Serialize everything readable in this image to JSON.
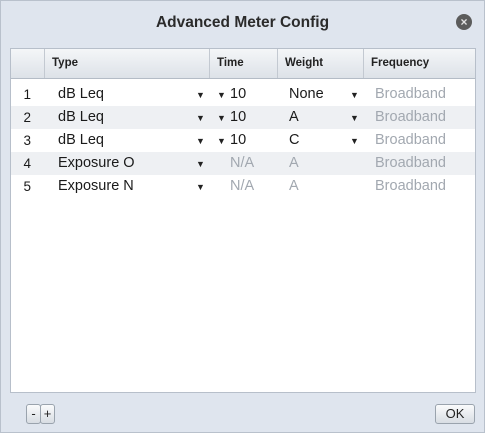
{
  "dialog": {
    "title": "Advanced Meter Config",
    "close_glyph": "×"
  },
  "table": {
    "columns": [
      "Type",
      "Time",
      "Weight",
      "Frequency"
    ],
    "rows": [
      {
        "num": "1",
        "type": "dB Leq",
        "time": "10",
        "weight": "None",
        "frequency": "Broadband",
        "time_enabled": true,
        "weight_enabled": true
      },
      {
        "num": "2",
        "type": "dB Leq",
        "time": "10",
        "weight": "A",
        "frequency": "Broadband",
        "time_enabled": true,
        "weight_enabled": true
      },
      {
        "num": "3",
        "type": "dB Leq",
        "time": "10",
        "weight": "C",
        "frequency": "Broadband",
        "time_enabled": true,
        "weight_enabled": true
      },
      {
        "num": "4",
        "type": "Exposure O",
        "time": "N/A",
        "weight": "A",
        "frequency": "Broadband",
        "time_enabled": false,
        "weight_enabled": false
      },
      {
        "num": "5",
        "type": "Exposure N",
        "time": "N/A",
        "weight": "A",
        "frequency": "Broadband",
        "time_enabled": false,
        "weight_enabled": false
      }
    ]
  },
  "footer": {
    "remove_label": "-",
    "add_label": "+",
    "ok_label": "OK"
  },
  "icons": {
    "dropdown": "chevron-down-icon",
    "close": "close-icon"
  }
}
